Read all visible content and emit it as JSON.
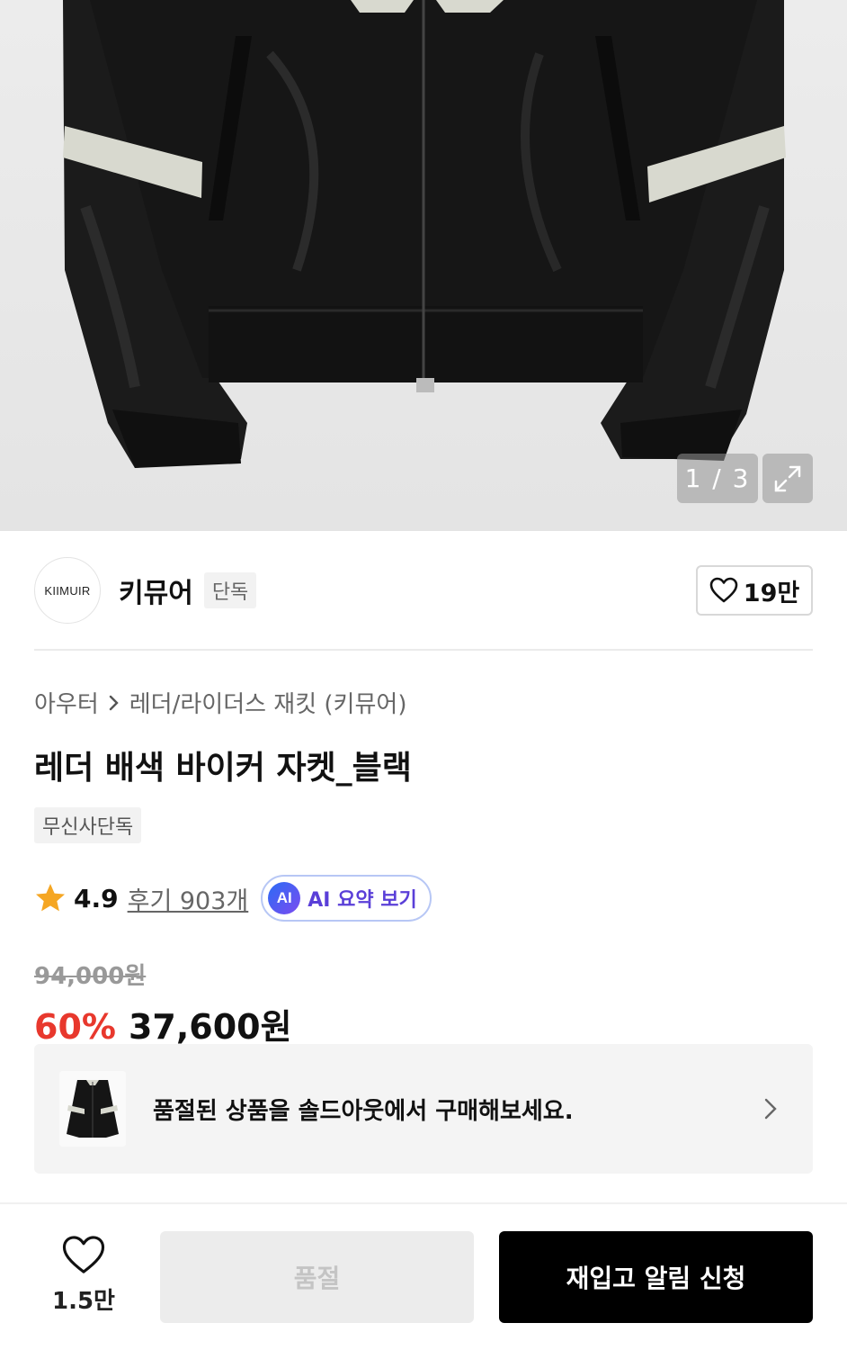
{
  "gallery": {
    "image_alt": "leather-jacket-photo",
    "counter": "1 / 3",
    "expand_icon": "expand-icon"
  },
  "brand": {
    "logo_text": "KIIMUIR",
    "name": "키뮤어",
    "tag": "단독",
    "like_count": "19만",
    "like_icon": "heart-outline-icon"
  },
  "breadcrumb": {
    "category": "아우터",
    "separator_icon": "chevron-right-icon",
    "subcategory": "레더/라이더스 재킷 (키뮤어)"
  },
  "product": {
    "title": "레더 배색 바이커 자켓_블랙",
    "badge": "무신사단독",
    "rating": "4.9",
    "rating_icon": "star-icon",
    "reviews": "후기 903개",
    "ai_icon_text": "AI",
    "ai_summary": "AI 요약 보기",
    "original_price": "94,000원",
    "discount": "60%",
    "sale_price": "37,600원"
  },
  "soldout_banner": {
    "text": "품절된 상품을 솔드아웃에서 구매해보세요.",
    "chevron_icon": "chevron-right-icon"
  },
  "bottom_bar": {
    "wish_icon": "heart-outline-icon",
    "wish_count": "1.5만",
    "soldout_label": "품절",
    "restock_label": "재입고 알림 신청"
  },
  "colors": {
    "discount_red": "#e8382d",
    "ai_purple": "#5a3fd8",
    "star_orange": "#f5a623",
    "primary_black": "#000000"
  }
}
